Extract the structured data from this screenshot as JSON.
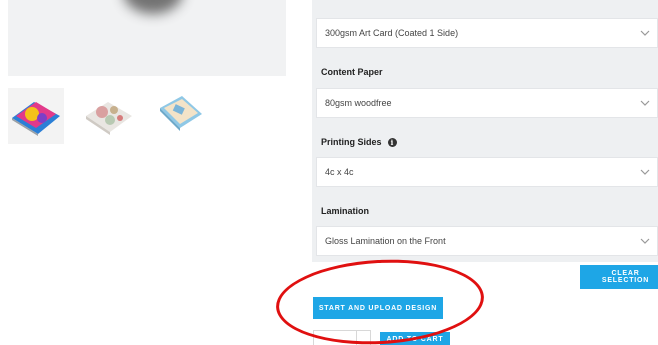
{
  "options": {
    "cover_paper_value": "300gsm Art Card (Coated 1 Side)",
    "content_paper_label": "Content Paper",
    "content_paper_value": "80gsm woodfree",
    "printing_sides_label": "Printing Sides",
    "printing_sides_value": "4c x 4c",
    "lamination_label": "Lamination",
    "lamination_value": "Gloss Lamination on the Front"
  },
  "actions": {
    "clear_selection_label": "CLEAR SELECTION",
    "start_upload_label": "START AND UPLOAD DESIGN",
    "add_to_cart_label": "ADD TO CART"
  },
  "icons": {
    "info": "info-icon",
    "chevron": "chevron-down-icon"
  },
  "colors": {
    "accent": "#1ea6e6",
    "annotation": "#e01010",
    "panel_bg": "#eef0f2"
  }
}
